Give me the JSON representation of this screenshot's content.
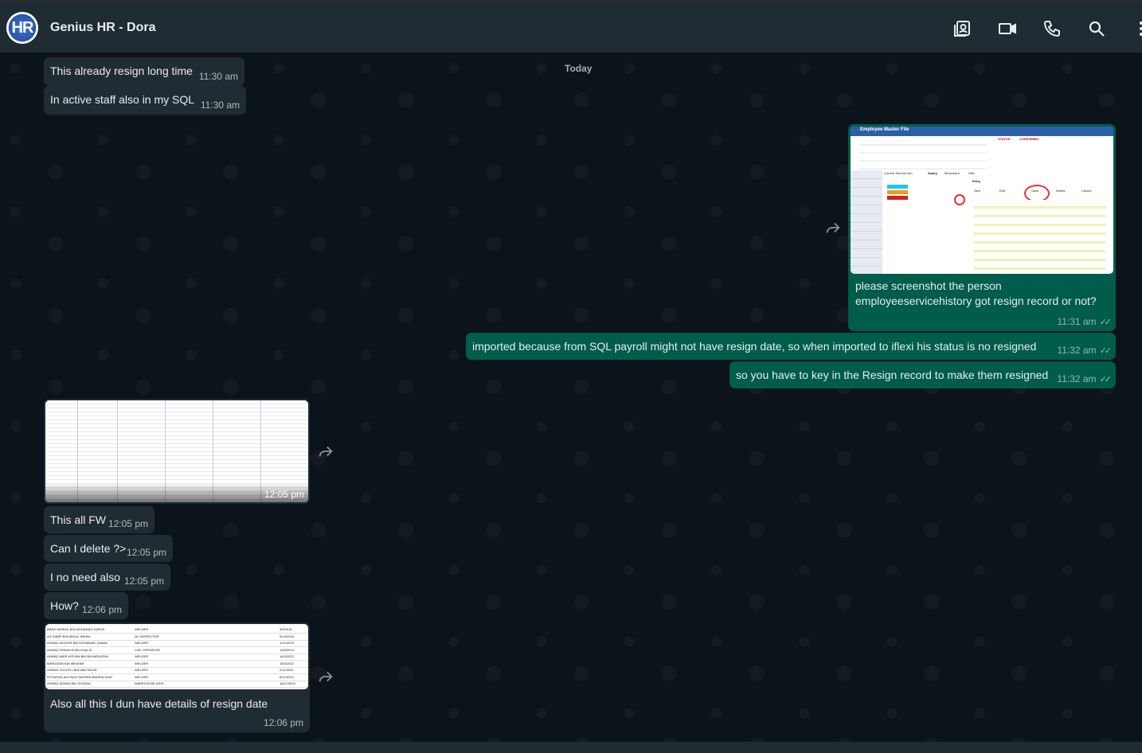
{
  "header": {
    "title": "Genius HR - Dora",
    "avatar_text": "HR"
  },
  "chat": {
    "date_divider": "Today",
    "messages": [
      {
        "text": "This already resign long time",
        "time": "11:30 am"
      },
      {
        "text": "In active staff also in my SQL",
        "time": "11:30 am"
      },
      {
        "text": "please screenshot the person employeeservicehistory got resign record or not?",
        "line1": "please screenshot the person",
        "line2": "employeeservicehistory got resign record or not?",
        "time": "11:31 am"
      },
      {
        "text": "imported because from SQL payroll might not have resign date, so when imported to iflexi his status is no resigned",
        "time": "11:32 am"
      },
      {
        "text": "so you have to key in the Resign record to make them resigned",
        "time": "11:32 am"
      },
      {
        "text": "",
        "time": "12:05 pm"
      },
      {
        "text": "This all FW",
        "time": "12:05 pm"
      },
      {
        "text": "Can I delete ?>",
        "time": "12:05 pm"
      },
      {
        "text": "I no need also",
        "time": "12:05 pm"
      },
      {
        "text": "How?",
        "time": "12:06 pm"
      },
      {
        "text": "Also all this I dun have details of resign date",
        "time": "12:06 pm"
      }
    ]
  },
  "screenshot_1": {
    "title": "Employee Master File",
    "status_label": "STATUS :",
    "status_value": "CONFIRMED",
    "tabs": [
      "Current Service Info",
      "Salary",
      "Movement",
      "Skill"
    ],
    "entry_label": "Entry",
    "buttons": [
      "New",
      "Edit",
      "Save",
      "Delete",
      "Cancel"
    ]
  },
  "screenshot_3": {
    "rows": [
      {
        "name": "AWAD AMIRUL BIN MOHAMAD DARUS",
        "position": "WELDER"
      },
      {
        "name": "AD SABRI BIN ABDUL RAHIM",
        "position": "QC INSPECTOR"
      },
      {
        "name": "AHMAD AKHYAR BIN MOHAMAD ZAINAL",
        "position": "WELDER"
      },
      {
        "name": "AHMAD FIRDAUS BIN KHALID",
        "position": "CNC OPERATOR"
      },
      {
        "name": "AHMAD AMIR HISYAM BIN BAHARUDDIN",
        "position": "WELDER"
      },
      {
        "name": "BARUDDIN BIN IBRAHIM",
        "position": "WELDER"
      },
      {
        "name": "AHMAD ZULKIFLI BIN ABD MAJID",
        "position": "WELDER"
      },
      {
        "name": "ROYAFAZLAN FAZLY BAHRIN BADRALSANI",
        "position": "WELDER"
      },
      {
        "name": "AHMAD ADNAN BIN GHAZALI",
        "position": "WAREHOUSE ASSI..."
      }
    ],
    "dates": [
      "3/5/2018",
      "9/14/2018",
      "12/1/2019",
      "13/9/2019",
      "14/3/2022",
      "16/3/2022",
      "2/11/2022",
      "6/12/2022",
      "16/11/2023"
    ]
  },
  "colors": {
    "incoming_bubble": "#202c33",
    "outgoing_bubble": "#005c4b",
    "background": "#0b141a",
    "header": "#202c33"
  }
}
